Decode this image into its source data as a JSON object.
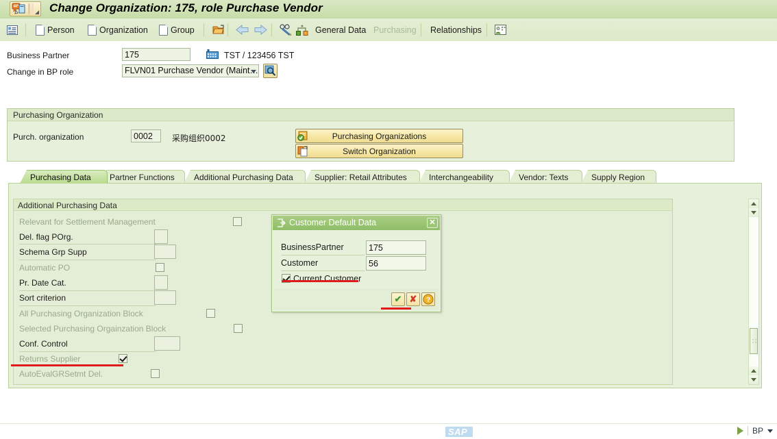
{
  "window": {
    "title": "Change Organization: 175, role Purchase Vendor",
    "title_icon": "bp-change-icon"
  },
  "toolbar": {
    "list_icon": "list-icon",
    "items": [
      {
        "label": "Person",
        "icon": "document-icon",
        "disabled": false
      },
      {
        "label": "Organization",
        "icon": "document-icon",
        "disabled": false
      },
      {
        "label": "Group",
        "icon": "document-icon",
        "disabled": false
      }
    ],
    "open_folder_icon": "open-folder-icon",
    "back_icon": "arrow-left-icon",
    "forward_icon": "arrow-right-icon",
    "glasses_icon": "glasses-pencil-icon",
    "hierarchy_icon": "relationship-hierarchy-icon",
    "nav": [
      {
        "label": "General Data",
        "disabled": false
      },
      {
        "label": "Purchasing",
        "disabled": true
      },
      {
        "label": "Relationships",
        "disabled": false
      }
    ],
    "card_icon": "business-card-icon"
  },
  "header": {
    "business_partner_label": "Business Partner",
    "business_partner_value": "175",
    "factory_icon": "factory-icon",
    "partner_description": "TST / 123456 TST",
    "bp_role_label": "Change in BP role",
    "bp_role_value": "FLVN01 Purchase Vendor (Maint…",
    "bp_role_search_icon": "magnifier-icon"
  },
  "purchasing_org": {
    "group_title": "Purchasing Organization",
    "porg_label": "Purch. organization",
    "porg_value": "0002",
    "porg_description": "采购组织0002",
    "buttons": [
      {
        "label": "Purchasing Organizations",
        "icon": "check-shield-icon"
      },
      {
        "label": "Switch Organization",
        "icon": "switch-page-icon"
      }
    ]
  },
  "tabs": [
    {
      "label": "Purchasing Data",
      "active": true
    },
    {
      "label": "Partner Functions",
      "active": false
    },
    {
      "label": "Additional Purchasing Data",
      "active": false
    },
    {
      "label": "Supplier: Retail Attributes",
      "active": false
    },
    {
      "label": "Interchangeability",
      "active": false
    },
    {
      "label": "Vendor: Texts",
      "active": false
    },
    {
      "label": "Supply Region",
      "active": false
    }
  ],
  "subscreen": {
    "title": "Additional Purchasing Data",
    "fields": [
      {
        "label": "Relevant for Settlement Management",
        "type": "checkbox",
        "dim": true,
        "checked": false
      },
      {
        "label": "Del. flag POrg.",
        "type": "input",
        "dim": false,
        "value": ""
      },
      {
        "label": "Schema Grp Supp",
        "type": "input",
        "dim": false,
        "value": ""
      },
      {
        "label": "Automatic PO",
        "type": "checkbox",
        "dim": true,
        "checked": false
      },
      {
        "label": "Pr. Date Cat.",
        "type": "input",
        "dim": false,
        "value": ""
      },
      {
        "label": "Sort criterion",
        "type": "input",
        "dim": false,
        "value": ""
      },
      {
        "label": "All Purchasing Organization Block",
        "type": "checkbox",
        "dim": true,
        "checked": false
      },
      {
        "label": "Selected Purchasing Orgainzation Block",
        "type": "checkbox",
        "dim": true,
        "checked": false
      },
      {
        "label": "Conf. Control",
        "type": "input",
        "dim": false,
        "value": ""
      },
      {
        "label": "Returns Supplier",
        "type": "checkbox",
        "dim": true,
        "checked": true
      },
      {
        "label": "AutoEvalGRSetmt Del.",
        "type": "checkbox",
        "dim": true,
        "checked": false
      }
    ]
  },
  "dialog": {
    "title": "Customer Default Data",
    "title_icon": "dialog-icon",
    "close_label": "✕",
    "fields": [
      {
        "label": "BusinessPartner",
        "value": "175"
      },
      {
        "label": "Customer",
        "value": "56"
      }
    ],
    "checkbox": {
      "label": "Current Customer",
      "checked": true
    },
    "buttons": [
      {
        "name": "confirm",
        "glyph": "✔",
        "color": "#3f9c35"
      },
      {
        "name": "cancel",
        "glyph": "✘",
        "color": "#cc3b27"
      },
      {
        "name": "help",
        "glyph": "?",
        "color": "#ffffff"
      }
    ]
  },
  "annotations": {
    "underline_count": 3
  },
  "statusbar": {
    "logo": "SAP",
    "transaction": "BP",
    "play_icon": "play-triangle-icon",
    "dropdown_icon": "chevron-down-icon"
  },
  "colors": {
    "title_bg": "#cfe2b4",
    "toolbar_bg": "#e0ebcf",
    "panel_bg": "#e7f0da",
    "tab_active": "#bcdc90",
    "dialog_title": "#99c471",
    "button_yellow": "#f2e3a5",
    "annotation_red": "#e01b1b",
    "disabled_text": "#9aa98a"
  }
}
